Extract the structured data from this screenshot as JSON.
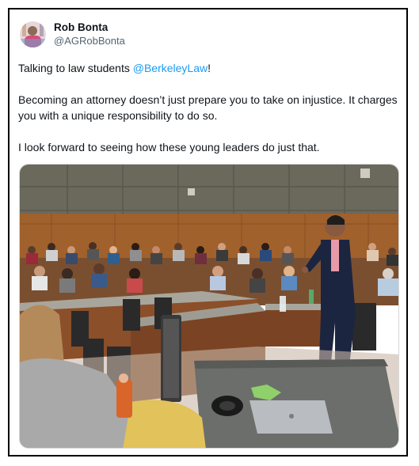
{
  "author": {
    "display_name": "Rob Bonta",
    "handle": "@AGRobBonta"
  },
  "tweet": {
    "line1_prefix": "Talking to law students ",
    "line1_mention": "@BerkeleyLaw",
    "line1_suffix": "!",
    "paragraph2": "Becoming an attorney doesn’t just prepare you to take on injustice. It charges you with a unique responsibility to do so.",
    "paragraph3": "I look forward to seeing how these young leaders do just that."
  },
  "colors": {
    "mention": "#1d9bf0",
    "handle": "#536471"
  }
}
